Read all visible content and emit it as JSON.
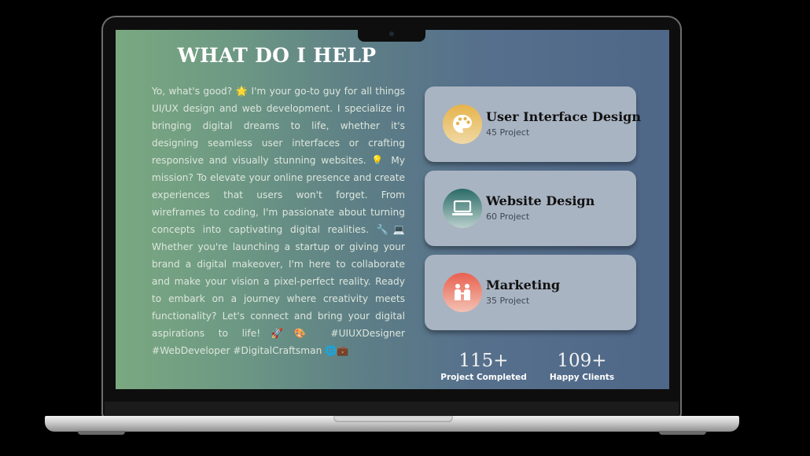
{
  "hero": {
    "title": "WHAT DO I HELP",
    "paragraph": "Yo, what's good? 🌟 I'm your go-to guy for all things UI/UX design and web development. I specialize in bringing digital dreams to life, whether it's designing seamless user interfaces or crafting responsive and visually stunning websites. 💡 My mission? To elevate your online presence and create experiences that users won't forget. From wireframes to coding, I'm passionate about turning concepts into captivating digital realities. 🔧💻 Whether you're launching a startup or giving your brand a digital makeover, I'm here to collaborate and make your vision a pixel-perfect reality. Ready to embark on a journey where creativity meets functionality? Let's connect and bring your digital aspirations to life!🚀🎨 #UIUXDesigner #WebDeveloper #DigitalCraftsman 🌐💼"
  },
  "services": [
    {
      "title": "User Interface Design",
      "count": "45 Project",
      "icon": "palette-icon",
      "accent": "#e6b34a"
    },
    {
      "title": "Website Design",
      "count": "60 Project",
      "icon": "laptop-icon",
      "accent": "#2b6b66"
    },
    {
      "title": "Marketing",
      "count": "35 Project",
      "icon": "people-icon",
      "accent": "#e8604f"
    }
  ],
  "stats": [
    {
      "value": "115+",
      "label": "Project Completed"
    },
    {
      "value": "109+",
      "label": "Happy Clients"
    }
  ]
}
